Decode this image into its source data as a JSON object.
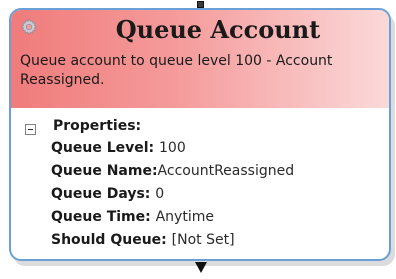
{
  "node": {
    "title": "Queue Account",
    "description": "Queue account to queue level 100 - Account Reassigned.",
    "header_gradient": [
      "#f07b7b",
      "#fbd9d9"
    ],
    "border_color": "#6aa0d8",
    "properties_heading": "Properties:",
    "properties": [
      {
        "key": "Queue Level: ",
        "value": "100"
      },
      {
        "key": "Queue Name:",
        "value": "AccountReassigned"
      },
      {
        "key": "Queue Days: ",
        "value": "0"
      },
      {
        "key": "Queue Time: ",
        "value": "Anytime"
      },
      {
        "key": "Should Queue: ",
        "value": "[Not Set]"
      }
    ]
  }
}
